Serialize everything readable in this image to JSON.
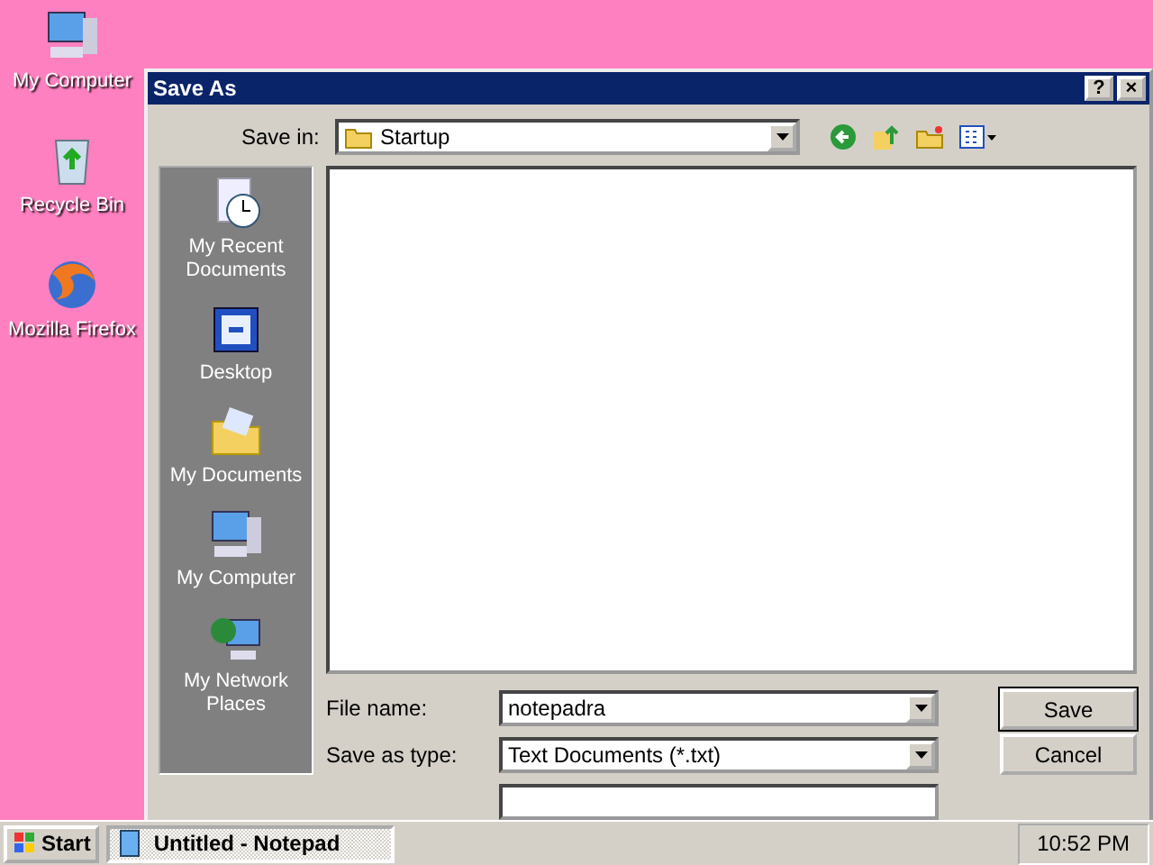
{
  "desktop_icons": [
    {
      "label": "My Computer",
      "kind": "computer"
    },
    {
      "label": "Recycle Bin",
      "kind": "recycle"
    },
    {
      "label": "Mozilla Firefox",
      "kind": "browser"
    }
  ],
  "dialog": {
    "title": "Save As",
    "help": "?",
    "close": "×",
    "save_in": {
      "label": "Save in:",
      "value": "Startup"
    },
    "places": [
      {
        "label": "My Recent Documents",
        "kind": "recent"
      },
      {
        "label": "Desktop",
        "kind": "desktop"
      },
      {
        "label": "My Documents",
        "kind": "documents"
      },
      {
        "label": "My Computer",
        "kind": "computer"
      },
      {
        "label": "My Network Places",
        "kind": "network"
      }
    ],
    "file_name": {
      "label": "File name:",
      "value": "notepadra"
    },
    "save_as_type": {
      "label": "Save as type:",
      "value": "Text Documents (*.txt)"
    },
    "buttons": [
      "Save",
      "Cancel"
    ]
  },
  "taskbar": {
    "start": "Start",
    "tasks": [
      {
        "label": "Untitled - Notepad",
        "selected": true
      }
    ],
    "clock": "10:52 PM"
  }
}
